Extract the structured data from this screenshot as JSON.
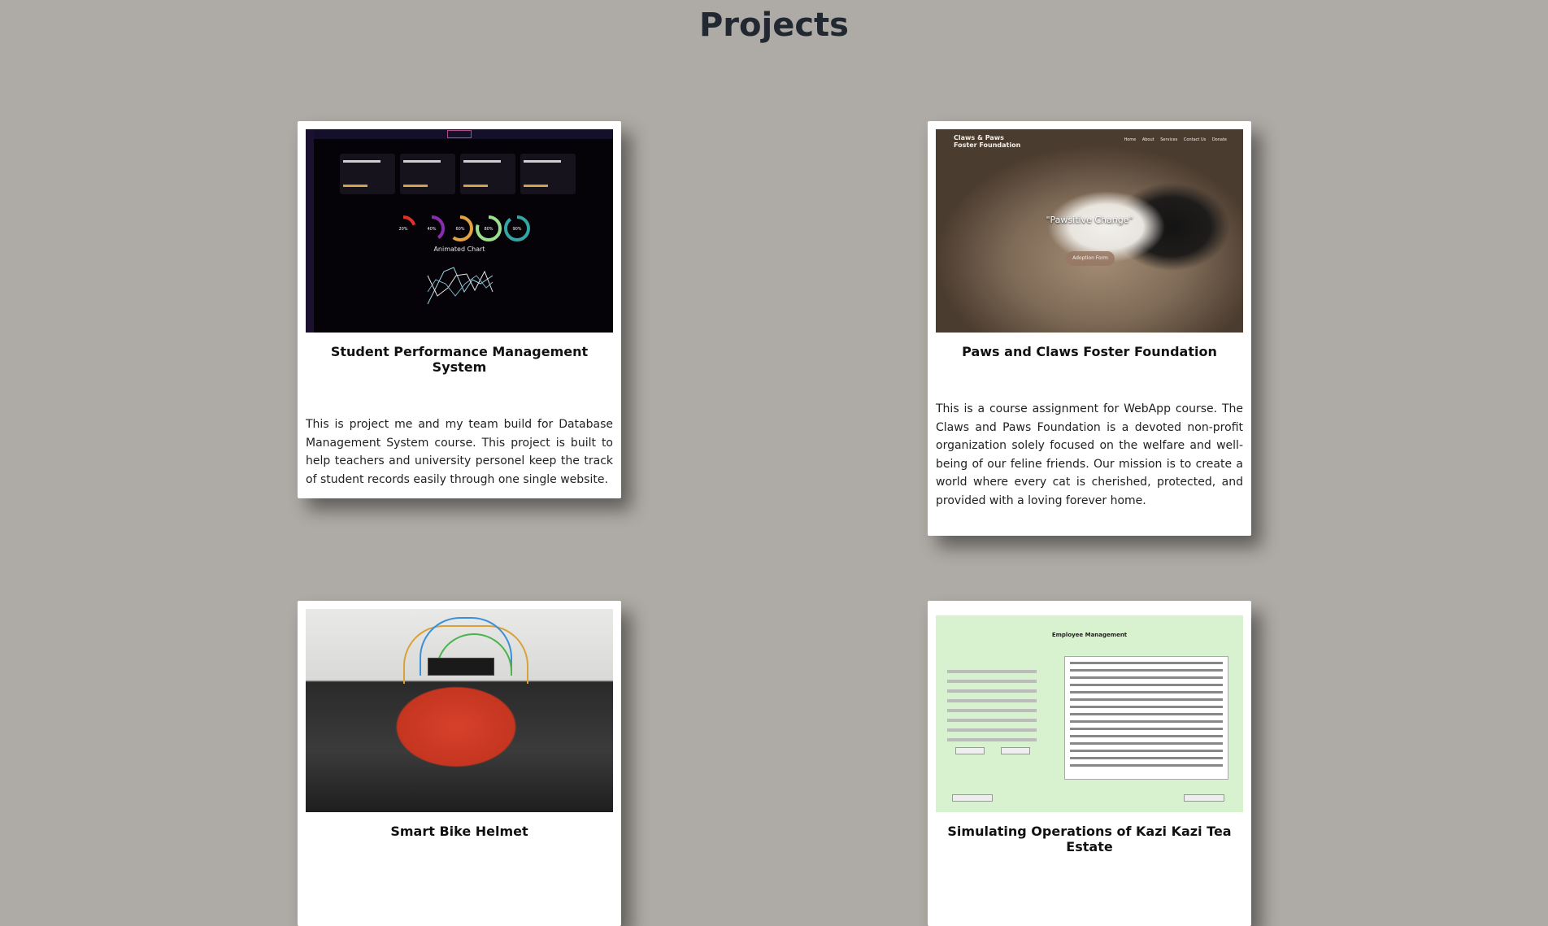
{
  "page": {
    "title": "Projects"
  },
  "projects": [
    {
      "title": "Student Performance Management System",
      "description": "This is project me and my team build for Database Management System course. This project is built to help teachers and university personel keep the track of student records easily through one single website.",
      "thumbnail": {
        "stats": [
          "Current Student Number",
          "Active Courses",
          "Active Instructors",
          "Enrollment Rate"
        ],
        "rings": [
          "20%",
          "40%",
          "60%",
          "80%",
          "90%"
        ],
        "ring_colors": [
          "#e0302b",
          "#8a2bb0",
          "#e0a340",
          "#9be08a",
          "#33a6a3"
        ],
        "chart_label": "Animated Chart"
      }
    },
    {
      "title": "Paws and Claws Foster Foundation",
      "description": "This is a course assignment for WebApp course. The Claws and Paws Foundation is a devoted non-profit organization solely focused on the welfare and well-being of our feline friends. Our mission is to create a world where every cat is cherished, protected, and provided with a loving forever home.",
      "thumbnail": {
        "brand_line1": "Claws & Paws",
        "brand_line2": "Foster Foundation",
        "nav": [
          "Home",
          "About",
          "Services",
          "Contact Us",
          "Donate"
        ],
        "tagline": "\"Pawsitive Change\"",
        "button": "Adoption Form"
      }
    },
    {
      "title": "Smart Bike Helmet",
      "description": ""
    },
    {
      "title": "Simulating Operations of Kazi Kazi Tea Estate",
      "description": "",
      "thumbnail": {
        "heading": "Employee Management"
      }
    }
  ]
}
